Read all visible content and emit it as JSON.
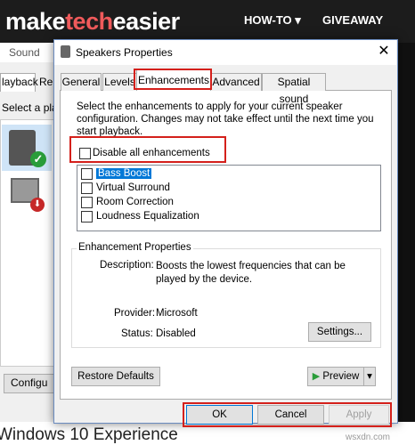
{
  "site": {
    "logo_part1": "make",
    "logo_part2": "tech",
    "logo_part3": "easier",
    "nav_howto": "HOW-TO ▾",
    "nav_giveaway": "GIVEAWAY",
    "bottom_text": "Windows 10 Experience",
    "watermark": "wsxdn.com"
  },
  "sound_window": {
    "title": "Sound",
    "tab_playback": "layback",
    "tab_recording": "Re",
    "select_text": "Select a playb",
    "configure_label": "Configu"
  },
  "dialog": {
    "title": "Speakers Properties",
    "close_glyph": "✕",
    "tabs": [
      "General",
      "Levels",
      "Enhancements",
      "Advanced",
      "Spatial sound"
    ],
    "instructions": "Select the enhancements to apply for your current speaker configuration. Changes may not take effect until the next time you start playback.",
    "disable_all_label": "Disable all enhancements",
    "enhancements": [
      "Bass Boost",
      "Virtual Surround",
      "Room Correction",
      "Loudness Equalization"
    ],
    "properties_legend": "Enhancement Properties",
    "description_key": "Description:",
    "description_val": "Boosts the lowest frequencies that can be played by the device.",
    "provider_key": "Provider:",
    "provider_val": "Microsoft",
    "status_key": "Status:",
    "status_val": "Disabled",
    "settings_label": "Settings...",
    "restore_label": "Restore Defaults",
    "preview_label": "Preview",
    "ok_label": "OK",
    "cancel_label": "Cancel",
    "apply_label": "Apply"
  },
  "colors": {
    "highlight": "#d4201b",
    "selection": "#0078d7",
    "logo_accent": "#f05a5b"
  }
}
